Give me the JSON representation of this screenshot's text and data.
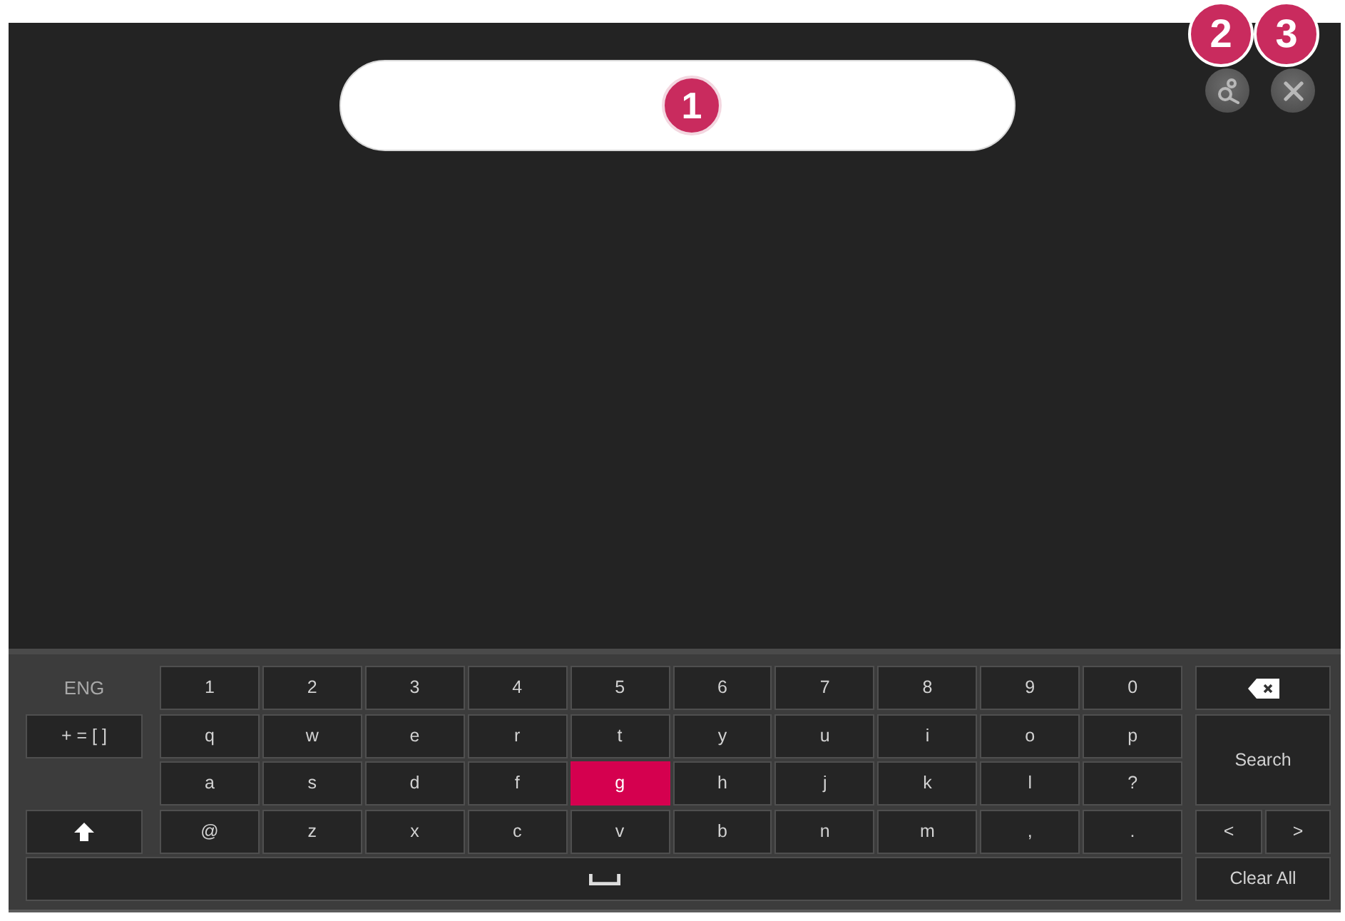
{
  "search_field": {
    "callout": "1"
  },
  "toolbar": [
    {
      "kind": "search",
      "callout": "2"
    },
    {
      "kind": "close",
      "callout": "3"
    }
  ],
  "keyboard": {
    "language": "ENG",
    "side_keys": [
      {
        "kind": "symbols",
        "label": "+ = [ ]",
        "selected": false
      },
      {
        "kind": "shift",
        "selected": false
      }
    ],
    "rows": [
      [
        {
          "label": "1",
          "selected": false
        },
        {
          "label": "2",
          "selected": false
        },
        {
          "label": "3",
          "selected": false
        },
        {
          "label": "4",
          "selected": false
        },
        {
          "label": "5",
          "selected": false
        },
        {
          "label": "6",
          "selected": false
        },
        {
          "label": "7",
          "selected": false
        },
        {
          "label": "8",
          "selected": false
        },
        {
          "label": "9",
          "selected": false
        },
        {
          "label": "0",
          "selected": false
        }
      ],
      [
        {
          "label": "q",
          "selected": false
        },
        {
          "label": "w",
          "selected": false
        },
        {
          "label": "e",
          "selected": false
        },
        {
          "label": "r",
          "selected": false
        },
        {
          "label": "t",
          "selected": false
        },
        {
          "label": "y",
          "selected": false
        },
        {
          "label": "u",
          "selected": false
        },
        {
          "label": "i",
          "selected": false
        },
        {
          "label": "o",
          "selected": false
        },
        {
          "label": "p",
          "selected": false
        }
      ],
      [
        {
          "label": "a",
          "selected": false
        },
        {
          "label": "s",
          "selected": false
        },
        {
          "label": "d",
          "selected": false
        },
        {
          "label": "f",
          "selected": false
        },
        {
          "label": "g",
          "selected": true
        },
        {
          "label": "h",
          "selected": false
        },
        {
          "label": "j",
          "selected": false
        },
        {
          "label": "k",
          "selected": false
        },
        {
          "label": "l",
          "selected": false
        },
        {
          "label": "?",
          "selected": false
        }
      ],
      [
        {
          "label": "@",
          "selected": false
        },
        {
          "label": "z",
          "selected": false
        },
        {
          "label": "x",
          "selected": false
        },
        {
          "label": "c",
          "selected": false
        },
        {
          "label": "v",
          "selected": false
        },
        {
          "label": "b",
          "selected": false
        },
        {
          "label": "n",
          "selected": false
        },
        {
          "label": "m",
          "selected": false
        },
        {
          "label": ",",
          "selected": false
        },
        {
          "label": ".",
          "selected": false
        }
      ]
    ],
    "space_key": {
      "selected": false
    },
    "action_keys": [
      {
        "kind": "backspace",
        "selected": false
      },
      {
        "kind": "search",
        "label": "Search",
        "selected": false
      },
      {
        "kind": "left",
        "label": "<",
        "selected": false
      },
      {
        "kind": "right",
        "label": ">",
        "selected": false
      },
      {
        "kind": "clear",
        "label": "Clear All",
        "selected": false
      }
    ]
  }
}
